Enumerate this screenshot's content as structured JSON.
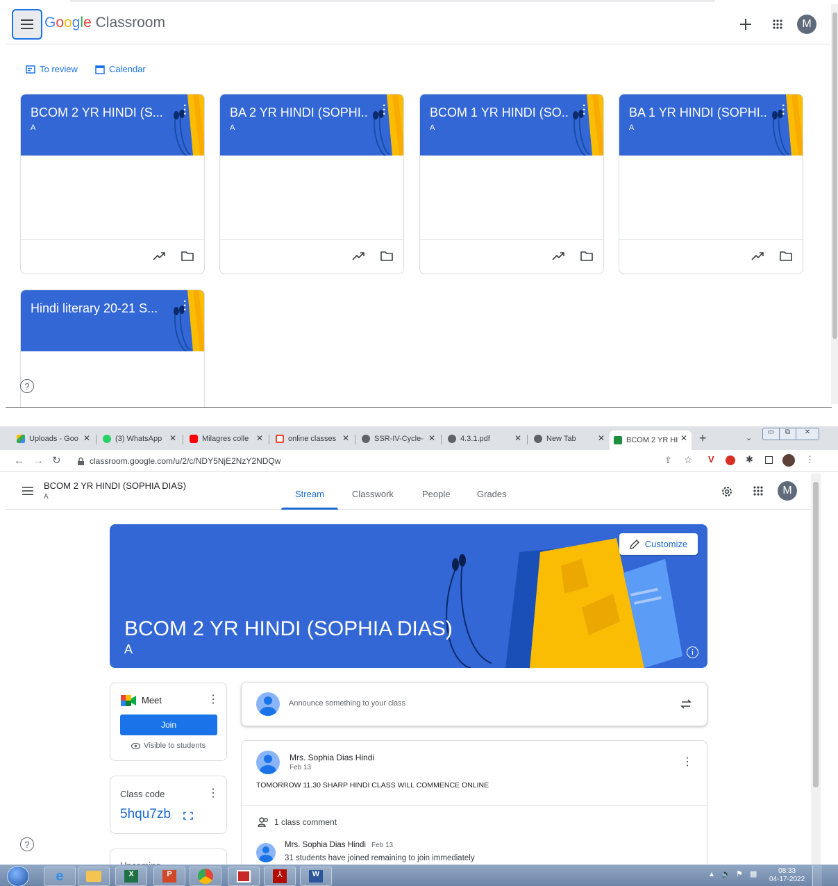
{
  "top": {
    "brand": {
      "google": "Google",
      "product": "Classroom"
    },
    "header": {
      "account_initial": "M"
    },
    "subnav": {
      "to_review": "To review",
      "calendar": "Calendar"
    },
    "classes": [
      {
        "title": "BCOM 2 YR HINDI (S...",
        "section": "A"
      },
      {
        "title": "BA 2 YR HINDI (SOPHI...",
        "section": "A"
      },
      {
        "title": "BCOM 1 YR HINDI (SO...",
        "section": "A"
      },
      {
        "title": "BA 1 YR HINDI (SOPHI...",
        "section": "A"
      },
      {
        "title": "Hindi literary 20-21 S...",
        "section": ""
      }
    ],
    "help": "?"
  },
  "browser": {
    "tabs": [
      {
        "label": "Uploads - Goo",
        "color": "#fbbc04"
      },
      {
        "label": "(3) WhatsApp",
        "color": "#25d366"
      },
      {
        "label": "Milagres colle",
        "color": "#ff0000"
      },
      {
        "label": "online classes",
        "color": "#ea4335"
      },
      {
        "label": "SSR-IV-Cycle-",
        "color": "#5f6368"
      },
      {
        "label": "4.3.1.pdf",
        "color": "#5f6368"
      },
      {
        "label": "New Tab",
        "color": "#5f6368"
      },
      {
        "label": "BCOM 2 YR HI",
        "color": "#1e8e3e"
      }
    ],
    "new_tab": "+",
    "url": "classroom.google.com/u/2/c/NDY5NjE2NzY2NDQw"
  },
  "classpage": {
    "title": "BCOM 2 YR HINDI (SOPHIA DIAS)",
    "section": "A",
    "nav": [
      "Stream",
      "Classwork",
      "People",
      "Grades"
    ],
    "account_initial": "M",
    "banner_title": "BCOM 2 YR HINDI (SOPHIA DIAS)",
    "banner_section": "A",
    "customize": "Customize",
    "meet": {
      "label": "Meet",
      "join": "Join",
      "visible": "Visible to students"
    },
    "class_code": {
      "label": "Class code",
      "code": "5hqu7zb"
    },
    "upcoming": "Upcoming",
    "announce_placeholder": "Announce something to your class",
    "post": {
      "author": "Mrs. Sophia Dias Hindi",
      "date": "Feb 13",
      "text": "TOMORROW 11.30 SHARP HINDI CLASS WILL COMMENCE ONLINE",
      "comments_label": "1 class comment",
      "comment": {
        "author": "Mrs. Sophia Dias Hindi",
        "date": "Feb 13",
        "text": "31 students have joined remaining to join immediately"
      }
    },
    "help": "?"
  },
  "taskbar": {
    "time": "08:33",
    "date": "04-17-2022"
  },
  "colors": {
    "banner": "#3367d6",
    "accent": "#1a73e8"
  }
}
